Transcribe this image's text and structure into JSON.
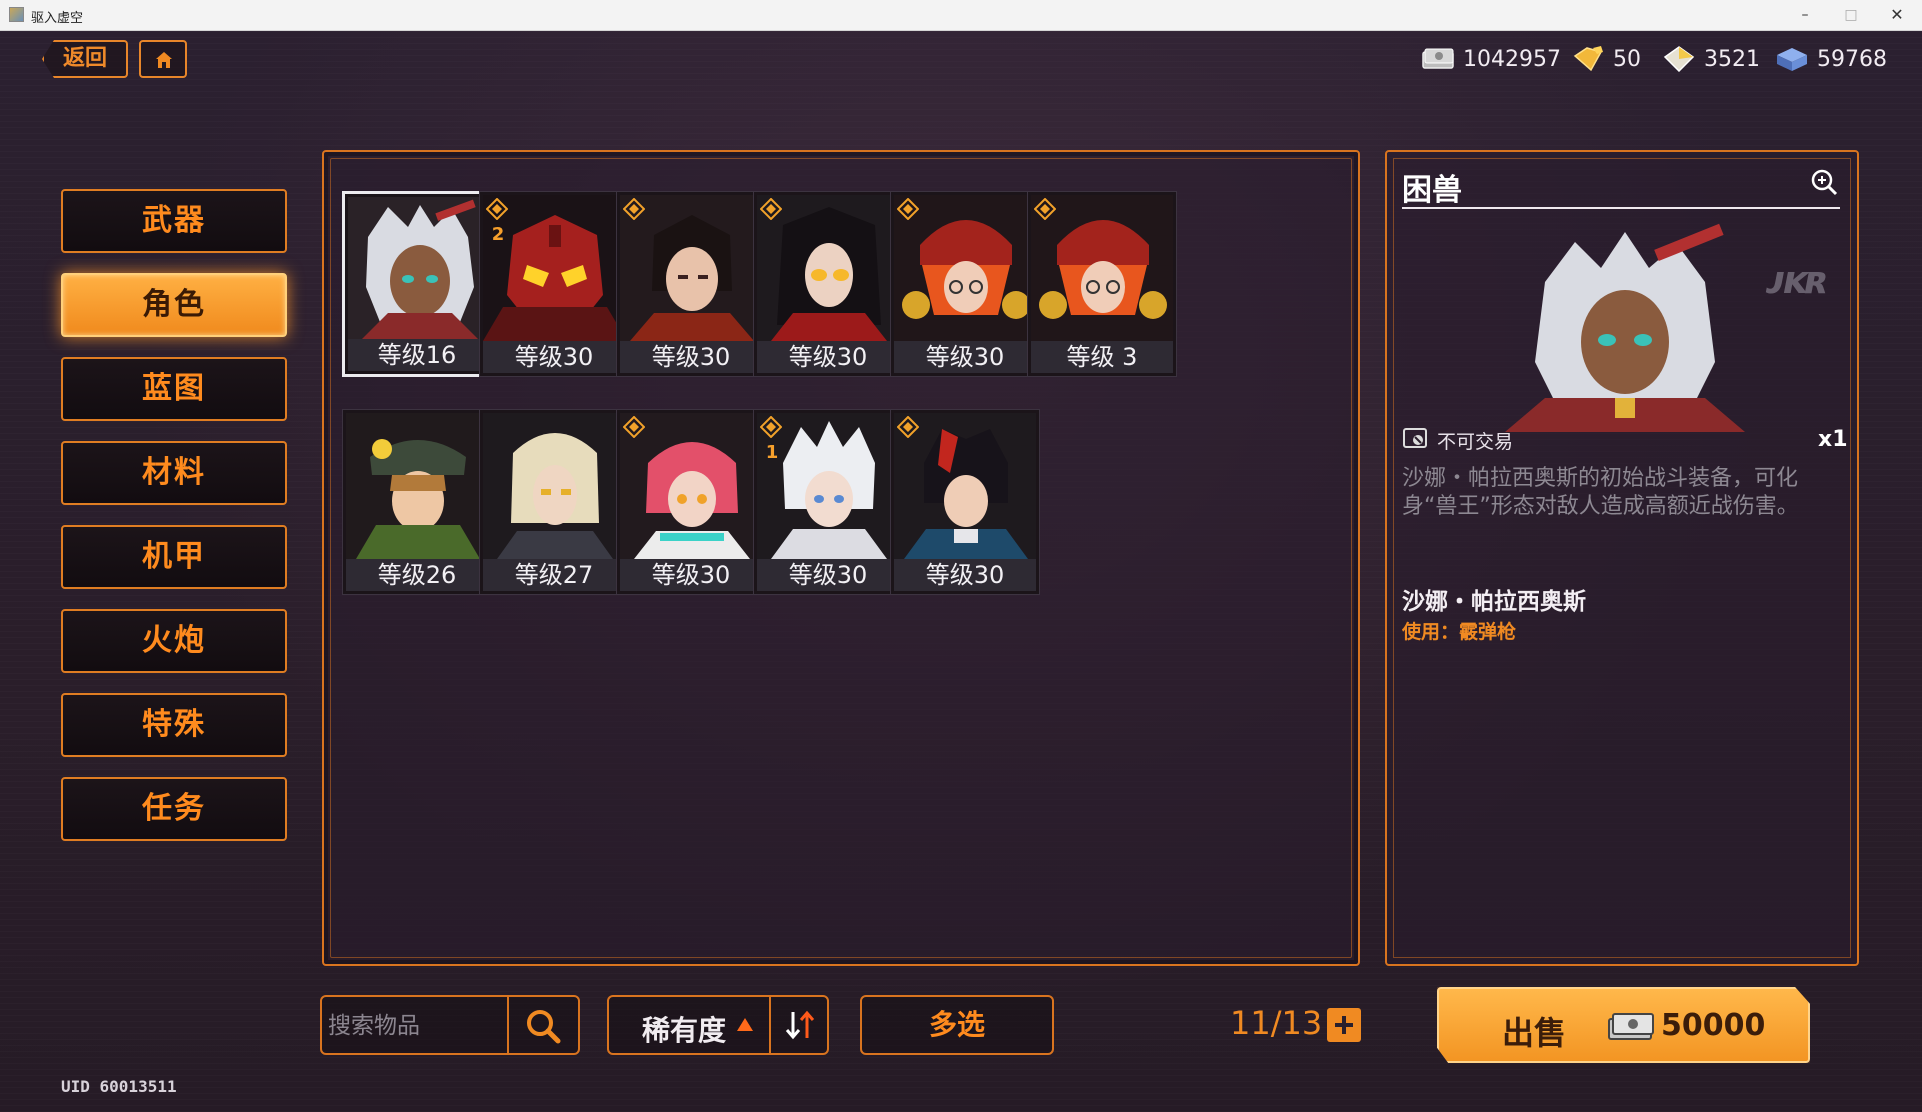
{
  "window": {
    "title": "驱入虚空",
    "min": "–",
    "max": "□",
    "close": "✕"
  },
  "nav": {
    "back_label": "返回",
    "home_icon": "home-icon"
  },
  "currencies": [
    {
      "name": "cash",
      "value": "1042957",
      "icon": "cash-icon",
      "color": "#c9c9c9"
    },
    {
      "name": "gold-crystal",
      "value": "50",
      "icon": "gold-crystal-icon",
      "color": "#f2b83a"
    },
    {
      "name": "silver-crystal",
      "value": "3521",
      "icon": "crystal-icon",
      "color": "#e6e1d2"
    },
    {
      "name": "blue-block",
      "value": "59768",
      "icon": "blue-block-icon",
      "color": "#6a8fd8"
    }
  ],
  "menu": [
    {
      "id": "weapon",
      "label": "武器",
      "active": false
    },
    {
      "id": "character",
      "label": "角色",
      "active": true
    },
    {
      "id": "blueprint",
      "label": "蓝图",
      "active": false
    },
    {
      "id": "material",
      "label": "材料",
      "active": false
    },
    {
      "id": "mecha",
      "label": "机甲",
      "active": false
    },
    {
      "id": "cannon",
      "label": "火炮",
      "active": false
    },
    {
      "id": "special",
      "label": "特殊",
      "active": false
    },
    {
      "id": "mission",
      "label": "任务",
      "active": false
    }
  ],
  "items": [
    {
      "level": "等级16",
      "selected": true,
      "badge": false,
      "num": "",
      "portrait": "silver-hair-tan-girl"
    },
    {
      "level": "等级30",
      "selected": false,
      "badge": true,
      "num": "2",
      "portrait": "red-helmet-robot"
    },
    {
      "level": "等级30",
      "selected": false,
      "badge": true,
      "num": "",
      "portrait": "dark-hair-red-armor"
    },
    {
      "level": "等级30",
      "selected": false,
      "badge": true,
      "num": "",
      "portrait": "black-hair-glasses-woman"
    },
    {
      "level": "等级30",
      "selected": false,
      "badge": true,
      "num": "",
      "portrait": "orange-hair-helmet-girl"
    },
    {
      "level": "等级 3",
      "selected": false,
      "badge": true,
      "num": "",
      "portrait": "orange-hair-helmet-girl"
    },
    {
      "level": "等级26",
      "selected": false,
      "badge": false,
      "num": "",
      "portrait": "green-coat-cap-boy"
    },
    {
      "level": "等级27",
      "selected": false,
      "badge": false,
      "num": "",
      "portrait": "blonde-man"
    },
    {
      "level": "等级30",
      "selected": false,
      "badge": true,
      "num": "",
      "portrait": "pink-hair-girl"
    },
    {
      "level": "等级30",
      "selected": false,
      "badge": true,
      "num": "1",
      "portrait": "white-hair-boy"
    },
    {
      "level": "等级30",
      "selected": false,
      "badge": true,
      "num": "",
      "portrait": "red-black-hair-boy"
    }
  ],
  "detail": {
    "title": "困兽",
    "zoom_icon": "zoom-in-icon",
    "watermark": "ᴊᴋʀ",
    "trade_label": "不可交易",
    "quantity": "x1",
    "description": "沙娜・帕拉西奥斯的初始战斗装备，可化身“兽王”形态对敌人造成高额近战伤害。",
    "owner": "沙娜・帕拉西奥斯",
    "use_prefix": "使用：",
    "use_value": "霰弹枪"
  },
  "bottom": {
    "search_placeholder": "搜索物品",
    "rarity_label": "稀有度",
    "multi_label": "多选",
    "capacity": "11/13",
    "sell_label": "出售",
    "sell_price": "50000"
  },
  "uid": "UID 60013511",
  "colors": {
    "accent": "#f08a22",
    "border": "#d9741f",
    "bg": "#2a1f2c"
  }
}
